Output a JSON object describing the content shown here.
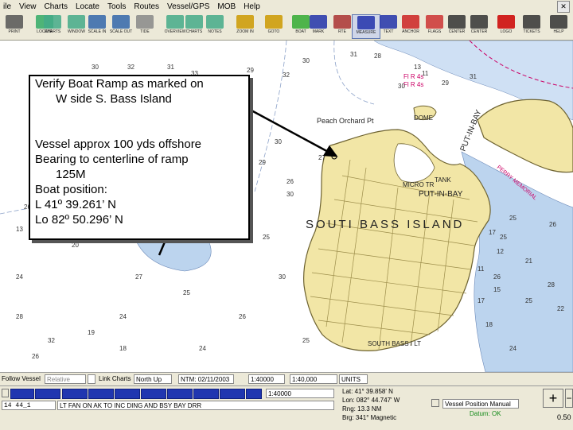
{
  "menu": [
    "File",
    "View",
    "Charts",
    "Locate",
    "Tools",
    "Routes",
    "Vessel/GPS",
    "MOB",
    "Help"
  ],
  "menu_display": [
    "ile",
    "View",
    "Charts",
    "Locate",
    "Tools",
    "Routes",
    "Vessel/GPS",
    "MOB",
    "Help"
  ],
  "toolbar": [
    {
      "icon": "print-icon",
      "label": "PRINT"
    },
    {
      "icon": "locate-icon",
      "label": "LOCATE"
    },
    {
      "icon": "chart-icon",
      "label": "CHARTS"
    },
    {
      "icon": "window-icon",
      "label": "WINDOW"
    },
    {
      "icon": "scale-in-icon",
      "label": "SCALE IN"
    },
    {
      "icon": "scale-out-icon",
      "label": "SCALE OUT"
    },
    {
      "icon": "tide-icon",
      "label": "TIDE"
    },
    {
      "icon": "overview-icon",
      "label": "OVERVIEW"
    },
    {
      "icon": "chart-icon",
      "label": "CHARTS"
    },
    {
      "icon": "notes-icon",
      "label": "NOTES"
    },
    {
      "icon": "zoom-in-icon",
      "label": "ZOOM IN"
    },
    {
      "icon": "go-to-icon",
      "label": "GOTO"
    },
    {
      "icon": "go-to-boat-icon",
      "label": "BOAT"
    },
    {
      "icon": "flag-icon",
      "label": "MARK"
    },
    {
      "icon": "route-icon",
      "label": "RTE"
    },
    {
      "icon": "measure-icon",
      "label": "MEASURE"
    },
    {
      "icon": "text-icon",
      "label": "TEXT"
    },
    {
      "icon": "anchor-icon",
      "label": "ANCHOR"
    },
    {
      "icon": "signal-flags-icon",
      "label": "FLAGS"
    },
    {
      "icon": "center-icon",
      "label": "CENTER"
    },
    {
      "icon": "center-icon",
      "label": "CENTER"
    },
    {
      "icon": "logo-icon",
      "label": "LOGO"
    },
    {
      "icon": "tickets-icon",
      "label": "TICKETS"
    },
    {
      "icon": "help-icon",
      "label": "HELP"
    }
  ],
  "chart": {
    "island_label": "SOUTH BASS ISLAND",
    "island_label_display": "SOUTI  BASS ISLAND",
    "put_in_bay": "PUT-IN-BAY",
    "put_in_bay_vertical": "PUT-IN-BAY",
    "peach_orchard": "Peach Orchard Pt",
    "dome": "DOME",
    "micro": "MICRO TR",
    "tank": "TANK",
    "south_bass_lt": "SOUTH BASS I LT",
    "memorial": "PERRY MEMORIAL",
    "light_label": "Fl R 4s",
    "light_label2": "Fl R 4s",
    "soundings": [
      "30",
      "32",
      "31",
      "33",
      "29",
      "32",
      "30",
      "31",
      "28",
      "30",
      "29",
      "31",
      "30",
      "29",
      "26",
      "25",
      "26",
      "27",
      "30",
      "25",
      "26",
      "21",
      "25",
      "28",
      "26",
      "25",
      "22",
      "24",
      "18",
      "17",
      "17",
      "12",
      "11",
      "15",
      "24",
      "27",
      "25",
      "32",
      "19",
      "18",
      "24",
      "26",
      "13",
      "11",
      "25",
      "13",
      "20",
      "30",
      "25",
      "28",
      "26",
      "24"
    ]
  },
  "callout": {
    "line1": "Verify  Boat Ramp as marked on",
    "line2": "W side S. Bass Island",
    "line3": "Vessel approx 100 yds offshore",
    "line4": "Bearing to centerline of ramp",
    "line5": "125M",
    "line6": "Boat position:",
    "line7": "L 41º 39.261’ N",
    "line8": "Lo 82º 50.296’ N"
  },
  "status_top": {
    "follow_vessel": "Follow Vessel",
    "relative": "Relative",
    "link_charts": "Link Charts",
    "north_up": "North Up",
    "ntm": "NTM: 02/11/2003",
    "scale": "1:40000",
    "chart_scale": "1:40,000",
    "units": "UNITS"
  },
  "status_bottom": {
    "zoom_scale": "1:40000",
    "page": "14 44_1",
    "scroll_text": "LT FAN  ON  AK  TO  INC DING  AND BSY BAY DRR",
    "lat": "Lat:    41° 39.858' N",
    "lon": "Lon:  082° 44.747' W",
    "rng": "Rng:   13.3 NM",
    "brg": "Brg:   341° Magnetic",
    "vessel_position": "Vessel Position Manual",
    "datum": "Datum: OK",
    "zoom_plus": "+",
    "zoom_minus": "−",
    "zoom_value": "0.50"
  },
  "colors": {
    "land": "#f2e6a6",
    "shoal": "#bcd4ee",
    "water": "#ffffff",
    "progress": "#2036b0",
    "magenta": "#cc0066"
  }
}
